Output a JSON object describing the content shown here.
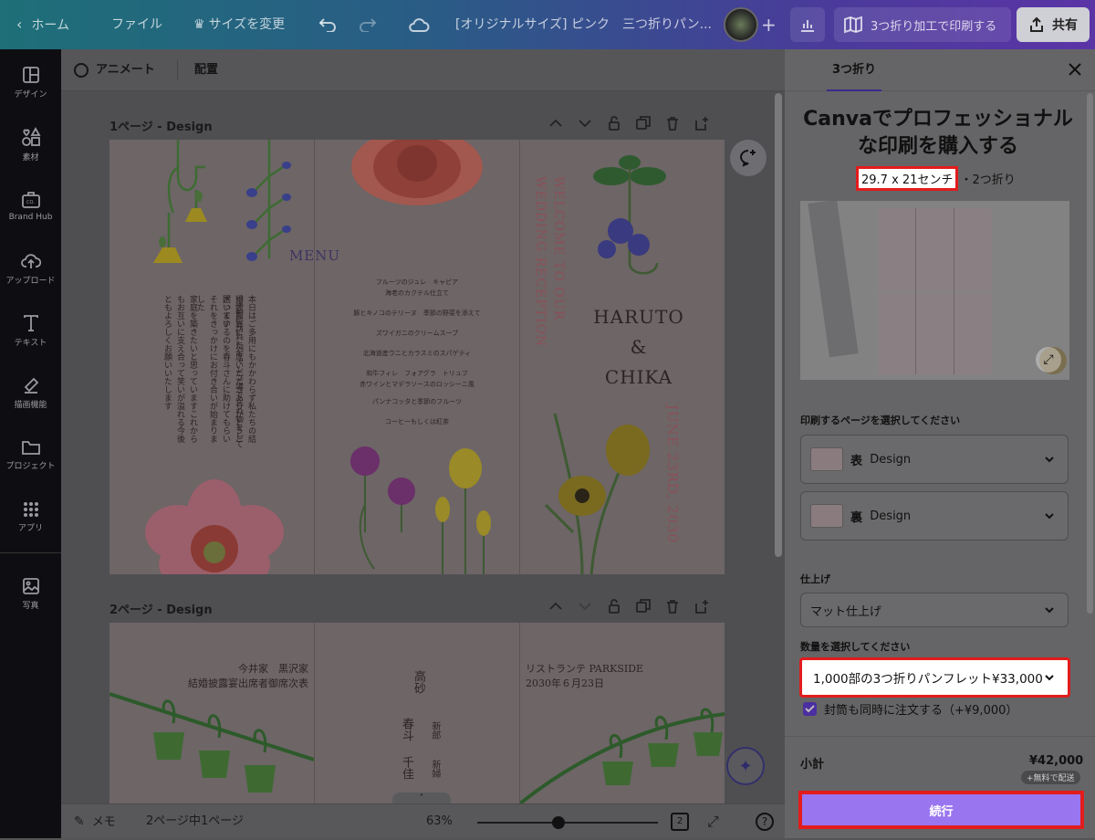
{
  "topbar": {
    "home": "ホーム",
    "file": "ファイル",
    "resize": "サイズを変更",
    "doc_title": "[オリジナルサイズ] ピンク　三つ折りパン...",
    "print_btn": "3つ折り加工で印刷する",
    "share": "共有"
  },
  "sidebar": {
    "items": [
      {
        "label": "デザイン",
        "icon": "layout-icon"
      },
      {
        "label": "素材",
        "icon": "elements-icon"
      },
      {
        "label": "Brand Hub",
        "icon": "brand-icon"
      },
      {
        "label": "アップロード",
        "icon": "upload-icon"
      },
      {
        "label": "テキスト",
        "icon": "text-icon"
      },
      {
        "label": "描画機能",
        "icon": "draw-icon"
      },
      {
        "label": "プロジェクト",
        "icon": "folder-icon"
      },
      {
        "label": "アプリ",
        "icon": "apps-icon"
      },
      {
        "label": "写真",
        "icon": "photo-icon"
      }
    ]
  },
  "subbar": {
    "animate": "アニメート",
    "position": "配置"
  },
  "pages": [
    {
      "label": "1ページ - Design"
    },
    {
      "label": "2ページ - Design"
    }
  ],
  "design": {
    "menu_title": "MENU",
    "menu_items": [
      "フルーツのジュレ　キャビア",
      "海老のカクテル仕立て",
      "豚とキノコのテリーヌ　季節の野菜を添えて",
      "ズワイガニのクリームスープ",
      "北海道産ウニとカラスミのスパゲティ",
      "和牛フィレ　フォアグラ　トリュフ",
      "赤ワインとマデラソースのロッシーニ風",
      "パンナコッタと季節のフルーツ",
      "コーヒーもしくは紅茶"
    ],
    "welcome": "WELCOME TO OUR WEDDING RECEPTION",
    "couple_1": "HARUTO",
    "couple_amp": "&",
    "couple_2": "CHIKA",
    "date": "JUNE 23RD, 2030",
    "greeting_1": "本日はご多用にもかかわらず私たちの結婚披露宴にご列席いただきありがとうございます",
    "greeting_2": "3年前に訪れたキャンプ場で忘れ物をして困っているのを春斗さんに助けてもらいそれをきっかけにお付き合いが始まりました",
    "greeting_3": "家庭を築きたいと思っていますこれからもお互いに支え合って笑いが溢れる今後ともよろしくお願いいたします",
    "families": "今井家　黒沢家",
    "seating": "結婚披露宴出席者御席次表",
    "venue": "リストランテ PARKSIDE",
    "venue_date": "2030年６月23日",
    "name_a": "高砂",
    "name_b": "春斗",
    "name_b_role": "新郎",
    "name_c": "千佳",
    "name_c_role": "新婦"
  },
  "bottombar": {
    "notes": "メモ",
    "page_count": "2ページ中1ページ",
    "zoom": "63%",
    "pages_badge": "2"
  },
  "panel": {
    "tab": "3つ折り",
    "title": "Canvaでプロフェッショナルな印刷を購入する",
    "size": "29.7 x 21センチ",
    "size_suffix": "・2つ折り",
    "pages_label": "印刷するページを選択してください",
    "front_prefix": "表",
    "front": "Design",
    "back_prefix": "裏",
    "back": "Design",
    "finish_label": "仕上げ",
    "finish": "マット仕上げ",
    "qty_label": "数量を選択してください",
    "qty": "1,000部の3つ折りパンフレット¥33,000",
    "envelope": "封筒も同時に注文する（+¥9,000）",
    "subtotal_label": "小計",
    "subtotal": "¥42,000",
    "free_ship": "+無料で配送",
    "continue": "続行"
  }
}
